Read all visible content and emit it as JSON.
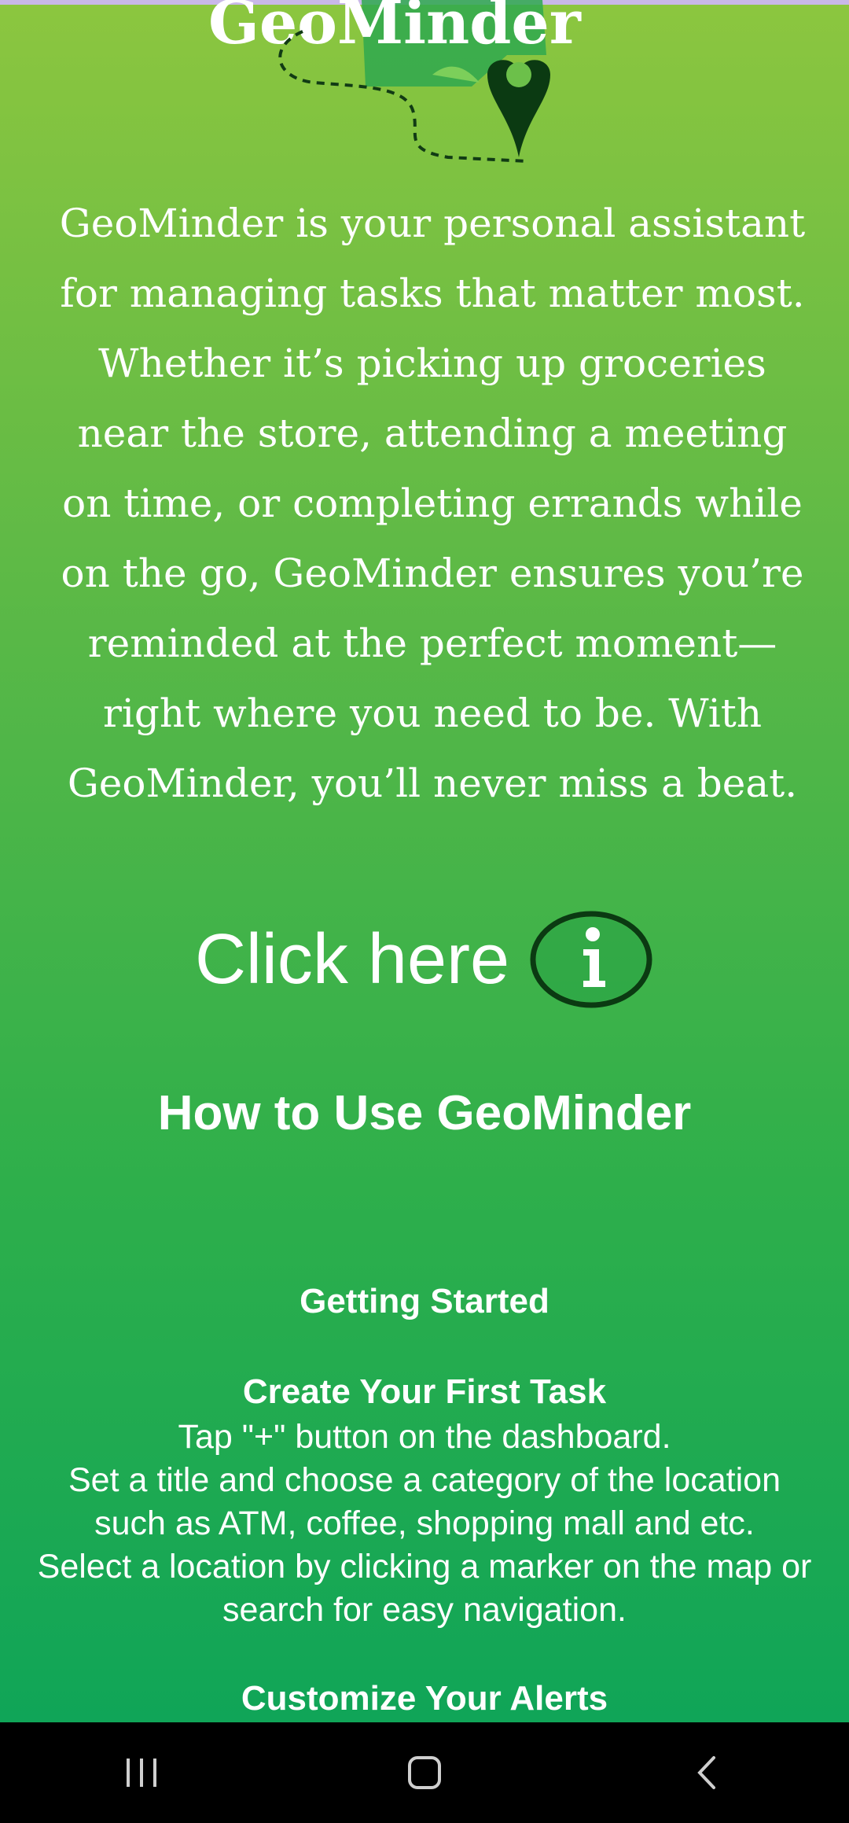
{
  "app": {
    "name": "GeoMinder"
  },
  "description": "GeoMinder is your personal assistant for managing tasks that matter most. Whether it’s picking up groceries near the store, attending a meeting on time, or completing errands while on the go, GeoMinder ensures you’re reminded at the perfect moment—right where you need to be. With GeoMinder, you’ll never miss a beat.",
  "info": {
    "click_label": "Click here"
  },
  "howto": {
    "title": "How to Use GeoMinder",
    "getting_started": "Getting Started",
    "create_task_title": "Create Your First Task",
    "steps": [
      "Tap \"+\" button on the dashboard.",
      "Set a title and choose a category of the location such as ATM, coffee, shopping mall and etc.",
      "Select a location by clicking a marker on the map or search for easy navigation."
    ],
    "customize_alerts_title": "Customize Your Alerts"
  },
  "colors": {
    "bg_top": "#8cc63f",
    "bg_bottom": "#0aa35a",
    "pin": "#0b3a12",
    "text": "#ffffff"
  }
}
